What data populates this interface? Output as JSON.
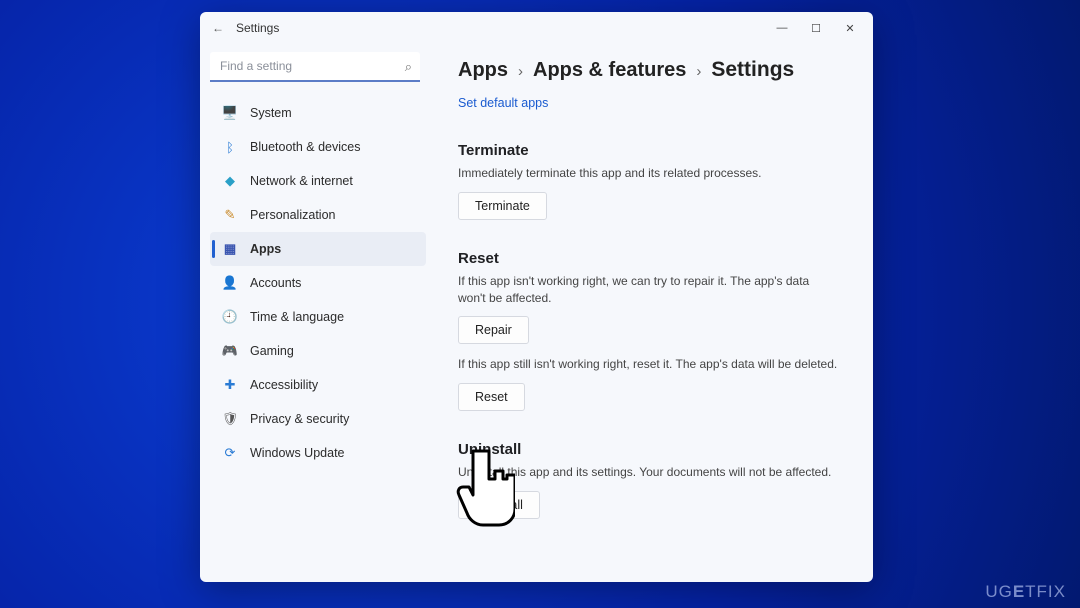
{
  "window": {
    "title": "Settings"
  },
  "search": {
    "placeholder": "Find a setting"
  },
  "sidebar": {
    "items": [
      {
        "label": "System",
        "icon": "🖥️",
        "color": "#2a7bd4"
      },
      {
        "label": "Bluetooth & devices",
        "icon": "ᛒ",
        "color": "#2a7bd4"
      },
      {
        "label": "Network & internet",
        "icon": "◆",
        "color": "#2aa0c7"
      },
      {
        "label": "Personalization",
        "icon": "✎",
        "color": "#c98a2a"
      },
      {
        "label": "Apps",
        "icon": "▦",
        "color": "#3a55b0",
        "selected": true
      },
      {
        "label": "Accounts",
        "icon": "👤",
        "color": "#3aa05a"
      },
      {
        "label": "Time & language",
        "icon": "🕘",
        "color": "#555"
      },
      {
        "label": "Gaming",
        "icon": "🎮",
        "color": "#555"
      },
      {
        "label": "Accessibility",
        "icon": "✚",
        "color": "#2a7bd4"
      },
      {
        "label": "Privacy & security",
        "icon": "🛡",
        "color": "#555"
      },
      {
        "label": "Windows Update",
        "icon": "⟳",
        "color": "#2a7bd4"
      }
    ]
  },
  "breadcrumbs": {
    "a": "Apps",
    "b": "Apps & features",
    "c": "Settings",
    "sep": "›"
  },
  "links": {
    "set_default": "Set default apps"
  },
  "sections": {
    "terminate": {
      "heading": "Terminate",
      "desc": "Immediately terminate this app and its related processes.",
      "button": "Terminate"
    },
    "reset": {
      "heading": "Reset",
      "repair_desc": "If this app isn't working right, we can try to repair it. The app's data won't be affected.",
      "repair_button": "Repair",
      "reset_desc": "If this app still isn't working right, reset it. The app's data will be deleted.",
      "reset_button": "Reset"
    },
    "uninstall": {
      "heading": "Uninstall",
      "desc": "Uninstall this app and its settings. Your documents will not be affected.",
      "button": "Uninstall"
    }
  },
  "watermark": {
    "a": "UG",
    "b": "E",
    "c": "TFIX"
  }
}
